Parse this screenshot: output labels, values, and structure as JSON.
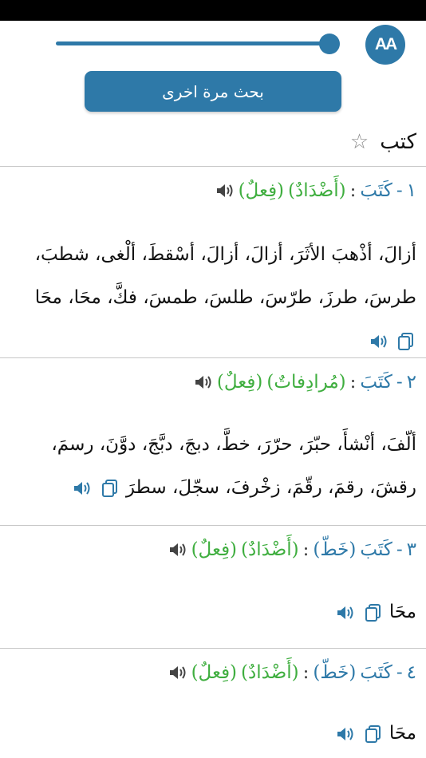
{
  "topbar": {
    "font_button_label": "AA",
    "slider_value": 0.96,
    "search_again_label": "بحث مرة اخرى"
  },
  "query": {
    "word": "كتب"
  },
  "entries": [
    {
      "number": "١",
      "word": "كَتَبَ",
      "word2": "",
      "type": "(أَضْدَادٌ)",
      "pos": "(فِعلٌ)",
      "text": "أزالَ، أذْهبَ الأثَرَ، أزالَ، أزالَ، أسْقطَ، ألْغى، شطبَ، طرسَ، طرزَ، طرّسَ، طلسَ، طمسَ، فكَّ، محَا، محَا"
    },
    {
      "number": "٢",
      "word": "كَتَبَ",
      "word2": "",
      "type": "(مُرادِفاتٌ)",
      "pos": "(فِعلٌ)",
      "text": "ألّفَ، أنْشأَ، حبّرَ، حرّرَ، خطَّ، دبجَ، دبَّجَ، دوَّنَ، رسمَ، رقشَ، رقمَ، رقّمَ، زخْرفَ، سجّلَ، سطرَ"
    },
    {
      "number": "٣",
      "word": "كَتَبَ",
      "word2": "(خَطّ)",
      "type": "(أَضْدَادٌ)",
      "pos": "(فِعلٌ)",
      "text": "محَا"
    },
    {
      "number": "٤",
      "word": "كَتَبَ",
      "word2": "(خَطّ)",
      "type": "(أَضْدَادٌ)",
      "pos": "(فِعلٌ)",
      "text": "محَا"
    }
  ],
  "colors": {
    "accent": "#2e79a8",
    "green": "#3fae3f"
  }
}
